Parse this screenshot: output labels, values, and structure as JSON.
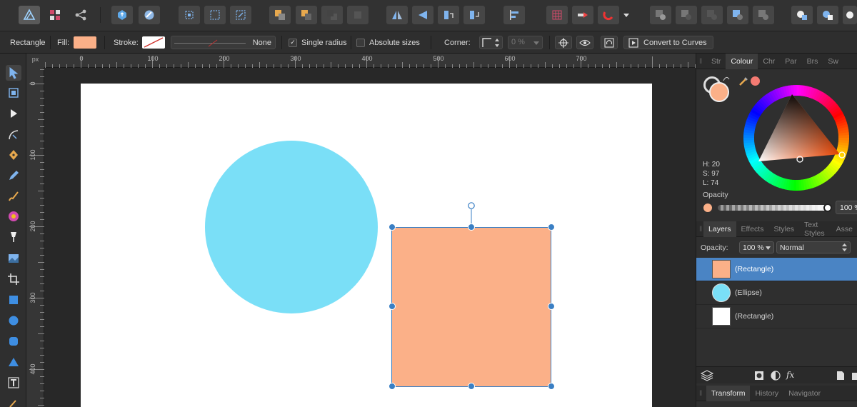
{
  "context_toolbar": {
    "shape_label": "Rectangle",
    "fill_label": "Fill:",
    "fill_color": "#fbb088",
    "stroke_label": "Stroke:",
    "stroke_style_value": "None",
    "single_radius_label": "Single radius",
    "single_radius_checked": true,
    "absolute_sizes_label": "Absolute sizes",
    "absolute_sizes_checked": false,
    "corner_label": "Corner:",
    "corner_value": "0 %",
    "convert_label": "Convert to Curves"
  },
  "rulers": {
    "unit": "px",
    "top_labels": [
      "0",
      "100",
      "200",
      "300",
      "400",
      "500",
      "600",
      "700"
    ],
    "left_labels": [
      "0",
      "100",
      "200",
      "300",
      "400"
    ]
  },
  "canvas": {
    "artboard_color": "#ffffff",
    "ellipse_color": "#7adff7",
    "rectangle_color": "#fbb088"
  },
  "colour_panel": {
    "tabs": [
      "Str",
      "Colour",
      "Chr",
      "Par",
      "Brs",
      "Sw"
    ],
    "active_tab": "Colour",
    "current_color": "#fbb088",
    "hue_label": "H: 20",
    "sat_label": "S: 97",
    "light_label": "L: 74",
    "opacity_label": "Opacity",
    "opacity_value": "100 %"
  },
  "layers_panel": {
    "tabs": [
      "Layers",
      "Effects",
      "Styles",
      "Text Styles",
      "Asse"
    ],
    "active_tab": "Layers",
    "opacity_label": "Opacity:",
    "opacity_value": "100 %",
    "blend_mode": "Normal",
    "layers": [
      {
        "name": "(Rectangle)",
        "color": "#fbb088",
        "shape": "rect",
        "selected": true
      },
      {
        "name": "(Ellipse)",
        "color": "#7adff7",
        "shape": "circle",
        "selected": false
      },
      {
        "name": "(Rectangle)",
        "color": "#ffffff",
        "shape": "rect",
        "selected": false
      }
    ]
  },
  "bottom_panel": {
    "tabs": [
      "Transform",
      "History",
      "Navigator"
    ],
    "active_tab": "Transform"
  }
}
